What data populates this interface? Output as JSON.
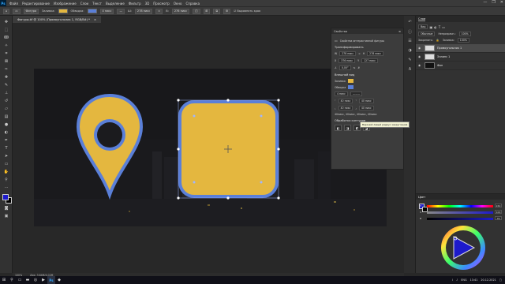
{
  "app": {
    "logo": "Ps",
    "menus": [
      "Файл",
      "Редактирование",
      "Изображение",
      "Слои",
      "Текст",
      "Выделение",
      "Фильтр",
      "3D",
      "Просмотр",
      "Окно",
      "Справка"
    ],
    "window_controls": [
      "—",
      "❐",
      "✕"
    ]
  },
  "options_bar": {
    "mode": "Фигура",
    "fill_label": "Заливка:",
    "stroke_label": "Обводка:",
    "stroke_width": "4 пикс",
    "w_label": "Ш:",
    "w_value": "278 пикс",
    "h_label": "В:",
    "h_value": "276 пикс",
    "align_edges": "Выровнять края",
    "fill_color": "#e4b73f",
    "stroke_color": "#5a7fd8"
  },
  "document": {
    "tab_title": "Фигуры.tif @ 100% (Прямоугольник 1, RGB/8#) *",
    "close": "×"
  },
  "properties": {
    "title": "Свойства",
    "subtitle": "Свойства интерактивной фигуры",
    "transform_title": "Трансформировать",
    "w": "278 пикс",
    "h": "278 пикс",
    "x": "376 пикс",
    "y": "127 пикс",
    "angle": "0,00°",
    "appearance_title": "Внешний вид",
    "fill_label": "Заливка",
    "stroke_label": "Обводка",
    "stroke_width": "4 пикс",
    "r1": "40 пикс",
    "r2": "40 пикс",
    "r3": "40 пикс",
    "r4": "40 пикс",
    "tooltip": "Верхний левый радиус закругления",
    "link_text": "40пикс, 40пикс, 40пикс, 40пикс",
    "ops_title": "Обработка контуров"
  },
  "layers_panel": {
    "tab": "Слои",
    "filter": "Вид",
    "mode": "Обычные",
    "opacity_label": "Непрозрачн.:",
    "opacity": "100%",
    "lock_label": "Закрепить:",
    "fill_label": "Заливка:",
    "fill": "100%",
    "layers": [
      {
        "name": "Прямоугольник 1",
        "selected": true
      },
      {
        "name": "Эллипс 1",
        "selected": false
      },
      {
        "name": "Фон",
        "selected": false
      }
    ]
  },
  "color_panel": {
    "tab": "Цвет",
    "h_label": "H",
    "s_label": "S",
    "b_label": "B",
    "h_value": "242",
    "s_value": "100",
    "b_value": "76"
  },
  "status": {
    "zoom": "100%",
    "doc_info": "Док: 3,64M/4,02M"
  },
  "taskbar": {
    "lang": "ENG",
    "time": "13:41",
    "date": "20.12.2021"
  },
  "colors": {
    "foreground": "#1d1acb",
    "background": "#000000",
    "shape_fill": "#e4b73f",
    "shape_stroke": "#5a7fd8"
  }
}
